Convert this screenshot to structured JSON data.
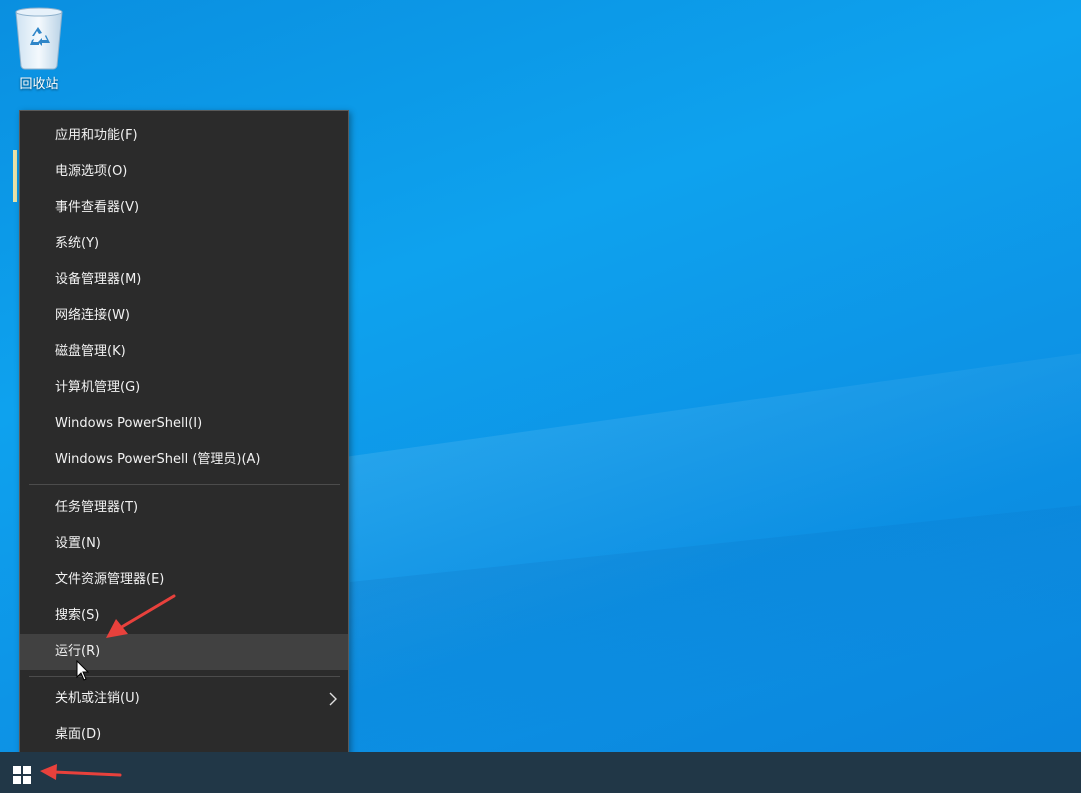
{
  "desktop": {
    "background_color": "#0e9ae9",
    "icons": [
      {
        "label": "回收站",
        "icon": "recycle-bin-icon"
      }
    ]
  },
  "context_menu": {
    "background_color": "#2b2b2b",
    "highlight_color": "#414141",
    "groups": [
      [
        {
          "label": "应用和功能(F)"
        },
        {
          "label": "电源选项(O)"
        },
        {
          "label": "事件查看器(V)"
        },
        {
          "label": "系统(Y)"
        },
        {
          "label": "设备管理器(M)"
        },
        {
          "label": "网络连接(W)"
        },
        {
          "label": "磁盘管理(K)"
        },
        {
          "label": "计算机管理(G)"
        },
        {
          "label": "Windows PowerShell(I)"
        },
        {
          "label": "Windows PowerShell (管理员)(A)"
        }
      ],
      [
        {
          "label": "任务管理器(T)"
        },
        {
          "label": "设置(N)"
        },
        {
          "label": "文件资源管理器(E)"
        },
        {
          "label": "搜索(S)"
        },
        {
          "label": "运行(R)",
          "highlighted": true
        }
      ],
      [
        {
          "label": "关机或注销(U)",
          "has_submenu": true,
          "submenu_icon": "chevron-right-icon"
        },
        {
          "label": "桌面(D)"
        }
      ]
    ]
  },
  "taskbar": {
    "background_color": "#213747",
    "start_icon": "windows-logo-icon"
  },
  "annotations": {
    "arrow_color": "#e8413c",
    "cursor_icon": "mouse-pointer-icon"
  }
}
